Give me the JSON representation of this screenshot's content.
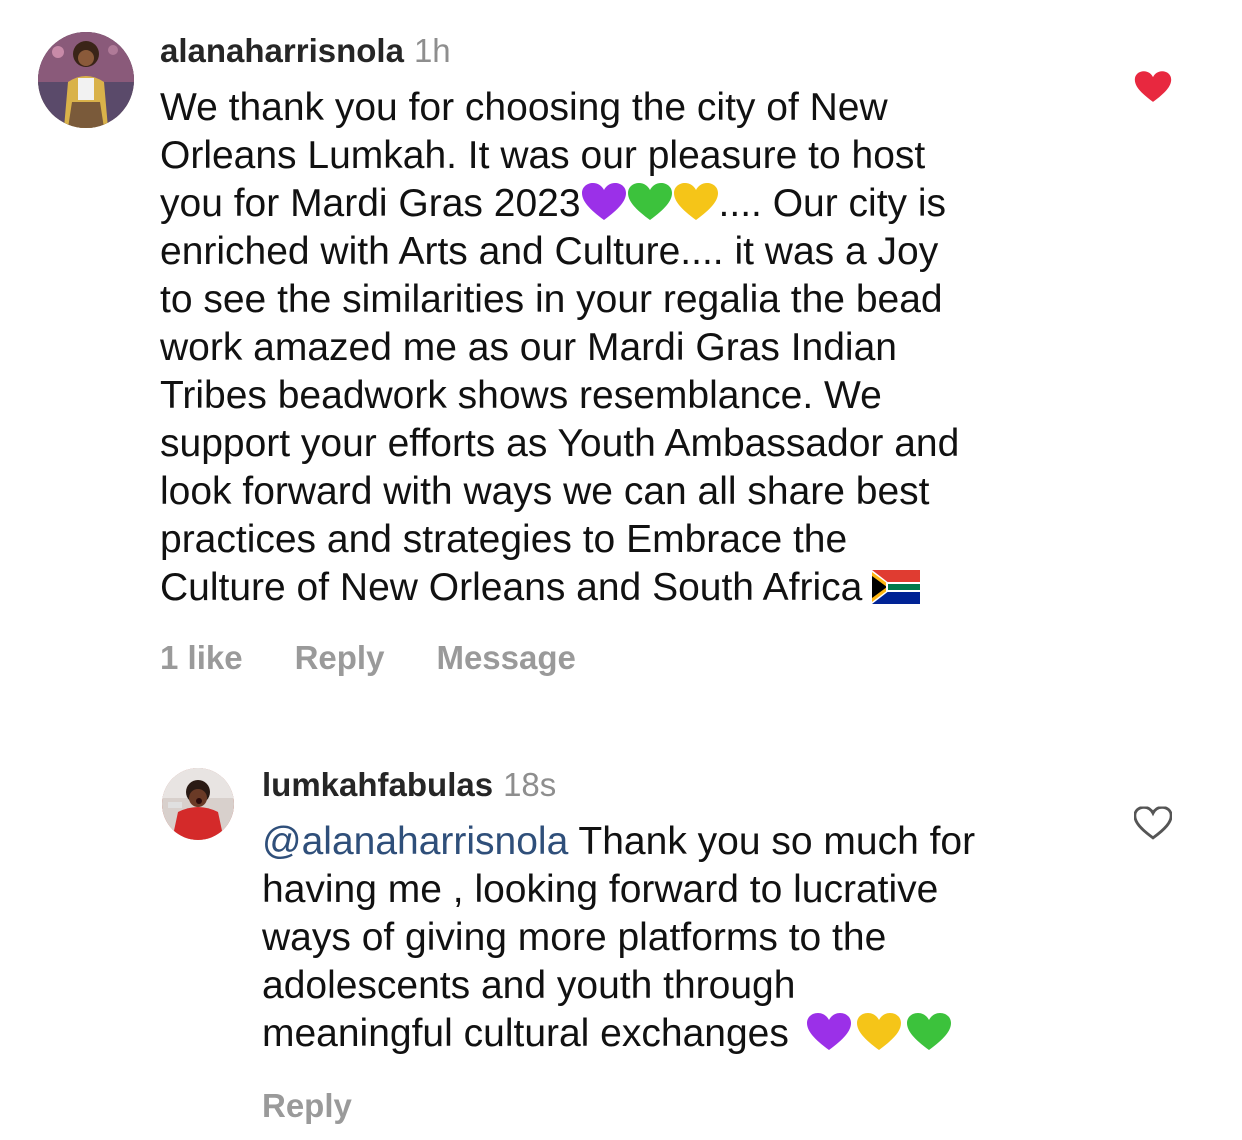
{
  "comments": [
    {
      "username": "alanaharrisnola",
      "time": "1h",
      "avatar_icon": "avatar-photo",
      "body_lines": [
        "We thank you for choosing the city of New",
        "Orleans Lumkah. It was our pleasure to host",
        "you for Mardi Gras 2023",
        ".... Our city is",
        "enriched with Arts and Culture.... it was a Joy",
        "to see the similarities in your regalia the bead",
        "work amazed me as our Mardi Gras Indian",
        "Tribes beadwork shows resemblance. We",
        "support your efforts as Youth Ambassador and",
        "look forward with ways we can all share best",
        "practices and strategies to Embrace the",
        "Culture of New Orleans and South Africa"
      ],
      "emojis": [
        "purple-heart",
        "green-heart",
        "yellow-heart",
        "south-africa-flag"
      ],
      "likes_label": "1 like",
      "reply_label": "Reply",
      "message_label": "Message",
      "liked": true,
      "heart_color": "#e8283f"
    },
    {
      "username": "lumkahfabulas",
      "time": "18s",
      "avatar_icon": "avatar-photo",
      "mention": "@alanaharrisnola",
      "body_lines": [
        "Thank you so much for",
        "having me , looking forward to lucrative",
        "ways of giving more platforms to the",
        "adolescents and youth through",
        "meaningful cultural exchanges"
      ],
      "emojis": [
        "purple-heart",
        "yellow-heart",
        "green-heart"
      ],
      "reply_label": "Reply",
      "liked": false
    }
  ],
  "colors": {
    "mention": "#2f4f7a",
    "muted": "#8e8e8e",
    "purple_heart": "#9b30e8",
    "green_heart": "#3cc23c",
    "yellow_heart": "#f5c518"
  }
}
